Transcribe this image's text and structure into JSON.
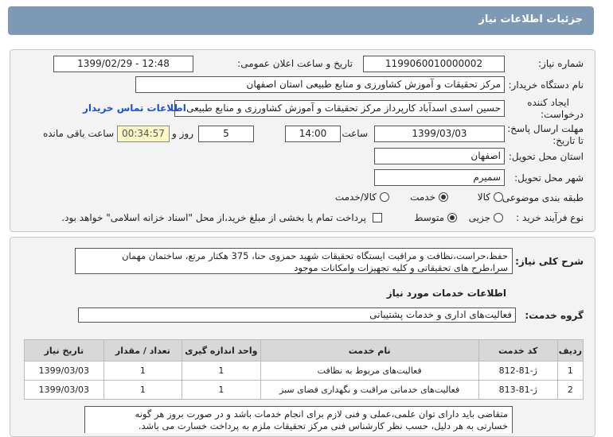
{
  "header": {
    "title": "جزئیات اطلاعات نیاز"
  },
  "info": {
    "need_number_label": "شماره نیاز:",
    "need_number": "1199060010000002",
    "announce_label": "تاریخ و ساعت اعلان عمومی:",
    "announce_value": "1399/02/29 - 12:48",
    "buyer_label": "نام دستگاه خریدار:",
    "buyer_value": "مرکز تحقیقات و آموزش کشاورزی و منابع طبیعی استان اصفهان",
    "creator_label_1": "ایجاد کننده",
    "creator_label_2": "درخواست:",
    "creator_value": "حسین اسدی اسدآباد کارپرداز مرکز تحقیقات و آموزش کشاورزی و منابع طبیعی",
    "contact_link": "اطلاعات تماس خریدار",
    "deadline_label_1": "مهلت ارسال پاسخ:",
    "deadline_label_2": "تا تاریخ:",
    "deadline_date": "1399/03/03",
    "time_label": "ساعت",
    "deadline_time": "14:00",
    "days_value": "5",
    "days_label": "روز و",
    "remaining_value": "00:34:57",
    "remaining_label": "ساعت باقی مانده",
    "province_label": "استان محل تحویل:",
    "province_value": "اصفهان",
    "city_label": "شهر محل تحویل:",
    "city_value": "سمیرم",
    "category_label": "طبقه بندی موضوعی:",
    "category_options": [
      "کالا",
      "خدمت",
      "کالا/خدمت"
    ],
    "category_selected": "خدمت",
    "process_label": "نوع فرآیند خرید :",
    "process_options": [
      "جزیی",
      "متوسط"
    ],
    "process_selected": "متوسط",
    "payment_text": "پرداخت تمام یا بخشی از مبلغ خرید،از محل \"اسناد خزانه اسلامی\" خواهد بود."
  },
  "details": {
    "summary_label": "شرح کلی نیاز:",
    "summary_line1": "حفظ،حراست،نظافت و مراقبت ایستگاه تحقیقات شهید حمزوی حنا، 375 هکتار مرتع، ساختمان مهمان",
    "summary_line2": "سرا،طرح های تحقیقاتی و کلیه تجهیزات وامکانات  موجود",
    "services_heading": "اطلاعات خدمات مورد نیاز",
    "group_label": "گروه خدمت:",
    "group_value": "فعالیت‌های اداری و خدمات پشتیبانی",
    "table_headers": [
      "ردیف",
      "کد خدمت",
      "نام خدمت",
      "واحد اندازه گیری",
      "تعداد / مقدار",
      "تاریخ نیاز"
    ],
    "rows": [
      [
        "1",
        "ژ-81-812",
        "فعالیت‌های مربوط به نظافت",
        "1",
        "1",
        "1399/03/03"
      ],
      [
        "2",
        "ژ-81-813",
        "فعالیت‌های خدماتی مراقبت و نگهداری فضای سبز",
        "1",
        "1",
        "1399/03/03"
      ]
    ],
    "note_line1": "متقاضی باید دارای توان علمی،عملی و فنی لازم  برای انجام خدمات  باشد و در صورت بروز هر گونه",
    "note_line2": "خسارتی به هر دلیل،  حسب نظر کارشناس فنی مرکز تحقیقات ملزم به پرداخت خسارت می باشد."
  }
}
